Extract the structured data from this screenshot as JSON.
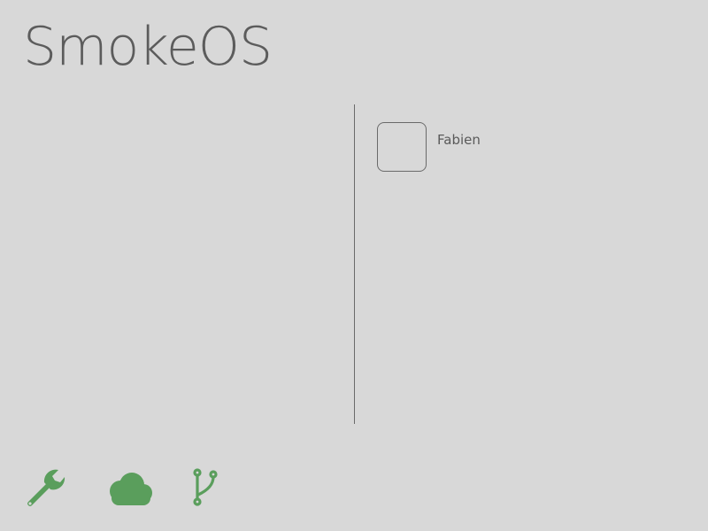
{
  "app": {
    "title": "SmokeOS"
  },
  "users": [
    {
      "name": "Fabien"
    }
  ],
  "toolbar": {
    "icons": [
      "wrench-icon",
      "cloud-icon",
      "git-branch-icon"
    ],
    "accent_color": "#5a9e5c"
  },
  "theme": {
    "background": "#d8d8d8",
    "text": "#5a5a5a"
  }
}
